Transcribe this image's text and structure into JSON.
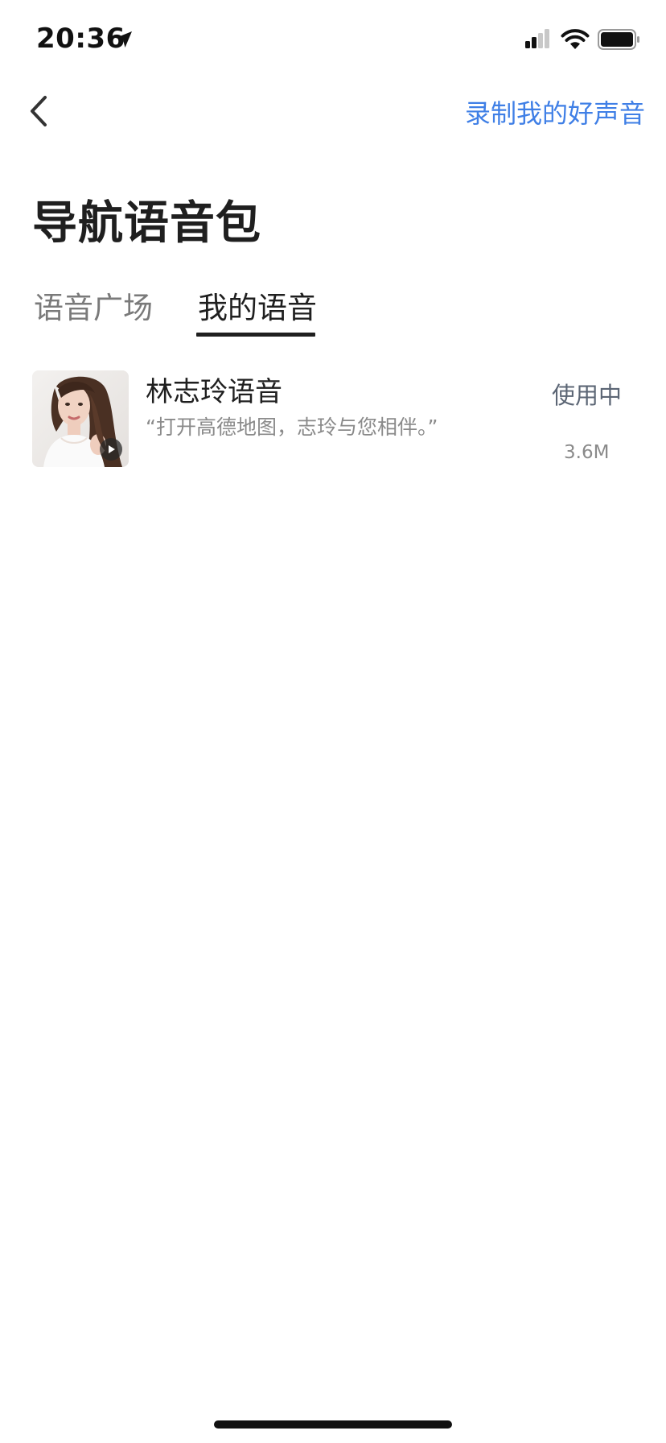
{
  "status_bar": {
    "time": "20:36"
  },
  "nav": {
    "back_icon": "chevron-left-icon",
    "record_link": "录制我的好声音"
  },
  "page": {
    "title": "导航语音包"
  },
  "tabs": [
    {
      "label": "语音广场",
      "active": false
    },
    {
      "label": "我的语音",
      "active": true
    }
  ],
  "voices": [
    {
      "name": "林志玲语音",
      "description": "“打开高德地图，志玲与您相伴。”",
      "status": "使用中",
      "size": "3.6M"
    }
  ],
  "colors": {
    "accent": "#3f7fe6",
    "text_primary": "#1f1f1f",
    "text_secondary": "#8a8a8a",
    "status_text": "#5c6675"
  }
}
